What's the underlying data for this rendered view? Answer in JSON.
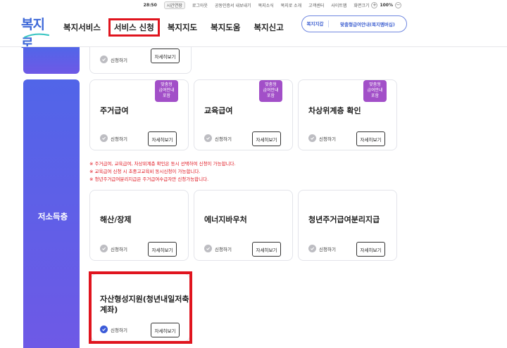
{
  "utility_bar": {
    "time": "28:50",
    "extend": "시간연장",
    "logout": "로그아웃",
    "cert": "공동인증서 내보내기",
    "news": "복지소식",
    "intro": "복지로 소개",
    "center": "고객센터",
    "sitemap": "사이트맵",
    "font_size": "화면크기",
    "plus": "+",
    "zoom": "100%",
    "minus": "−"
  },
  "logo": {
    "text": "복지로"
  },
  "gnb": {
    "items": [
      "복지서비스",
      "서비스 신청",
      "복지지도",
      "복지도움",
      "복지신고"
    ]
  },
  "right_pill": {
    "a": "복지지갑",
    "b": "맞춤형급여안내(복지멤버십)"
  },
  "side": {
    "category": "저소득층"
  },
  "cards": [
    {
      "title": "",
      "apply": "신청하기",
      "detail": "자세히보기"
    },
    {
      "title": "주거급여",
      "apply": "신청하기",
      "detail": "자세히보기",
      "badge": [
        "맞춤형",
        "급여안내",
        "포함"
      ]
    },
    {
      "title": "교육급여",
      "apply": "신청하기",
      "detail": "자세히보기",
      "badge": [
        "맞춤형",
        "급여안내",
        "포함"
      ]
    },
    {
      "title": "차상위계층 확인",
      "apply": "신청하기",
      "detail": "자세히보기",
      "badge": [
        "맞춤형",
        "급여안내",
        "포함"
      ]
    },
    {
      "title": "해산/장제",
      "apply": "신청하기",
      "detail": "자세히보기"
    },
    {
      "title": "에너지바우처",
      "apply": "신청하기",
      "detail": "자세히보기"
    },
    {
      "title": "청년주거급여분리지급",
      "apply": "신청하기",
      "detail": "자세히보기"
    },
    {
      "title_line1": "자산형성지원(청년내일저축",
      "title_line2": "계좌)",
      "apply": "신청하기",
      "detail": "자세히보기",
      "checked": true
    }
  ],
  "notes": [
    "※ 주거급여, 교육급여, 차상위계층 확인은 동시 선택하여 신청이 가능합니다.",
    "※ 교육급여 신청 시 초중고교육비 동시신청이 가능합니다.",
    "※ 청년주거급여분리지급은 주거급여수급자만 신청가능합니다."
  ],
  "colors": {
    "accent": "#3b5bd8",
    "side_gradient_top": "#5165e8",
    "side_gradient_bottom": "#6e59e6",
    "badge": "#a24fc8",
    "highlight": "#e0141e"
  }
}
